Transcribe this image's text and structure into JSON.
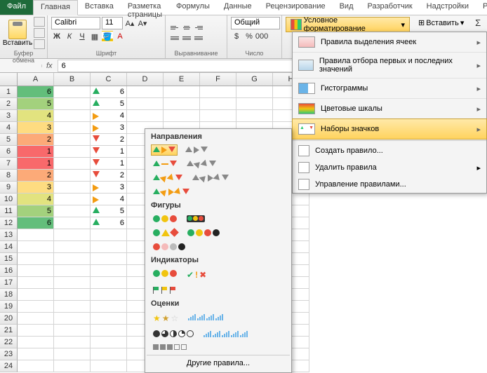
{
  "tabs": {
    "file": "Файл",
    "home": "Главная",
    "insert": "Вставка",
    "pagelayout": "Разметка страницы",
    "formulas": "Формулы",
    "data": "Данные",
    "review": "Рецензирование",
    "view": "Вид",
    "developer": "Разработчик",
    "addins": "Надстройки",
    "powerp": "PowerP"
  },
  "ribbon": {
    "paste": "Вставить",
    "clipboard": "Буфер обмена",
    "font_name": "Calibri",
    "font_size": "11",
    "font": "Шрифт",
    "alignment": "Выравнивание",
    "number_format": "Общий",
    "number": "Число",
    "cond_format": "Условное форматирование",
    "insert_cells": "Вставить",
    "sigma": "Σ"
  },
  "formula_bar": {
    "fx": "fx",
    "value": "6"
  },
  "columns": [
    "A",
    "B",
    "C",
    "D",
    "E",
    "F",
    "G",
    "H"
  ],
  "row_labels": [
    "1",
    "2",
    "3",
    "4",
    "5",
    "6",
    "7",
    "8",
    "9",
    "10",
    "11",
    "12",
    "13",
    "14",
    "15",
    "16",
    "17",
    "18",
    "19",
    "20",
    "21",
    "22",
    "23",
    "24"
  ],
  "data_a": [
    6,
    5,
    4,
    3,
    2,
    1,
    1,
    2,
    3,
    4,
    5,
    6
  ],
  "data_c": [
    6,
    5,
    4,
    3,
    2,
    1,
    1,
    2,
    3,
    4,
    5,
    6
  ],
  "icons_c": [
    "up",
    "up",
    "side",
    "side",
    "dn",
    "dn",
    "dn",
    "dn",
    "side",
    "side",
    "up",
    "up"
  ],
  "cf_menu": {
    "highlight": "Правила выделения ячеек",
    "topbottom": "Правила отбора первых и последних значений",
    "databars": "Гистограммы",
    "colorscales": "Цветовые шкалы",
    "iconsets": "Наборы значков",
    "new_rule": "Создать правило...",
    "clear": "Удалить правила",
    "manage": "Управление правилами..."
  },
  "iconset_panel": {
    "directions": "Направления",
    "shapes": "Фигуры",
    "indicators": "Индикаторы",
    "ratings": "Оценки",
    "more": "Другие правила..."
  }
}
